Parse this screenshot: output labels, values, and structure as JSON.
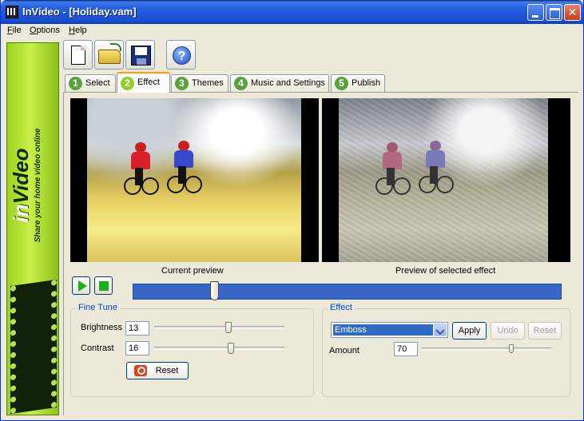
{
  "window": {
    "title": "InVideo - [Holiday.vam]"
  },
  "menu": [
    "File",
    "Options",
    "Help"
  ],
  "banner": {
    "logo_in": "in",
    "logo_video": "Video",
    "tagline": "Share your home video online"
  },
  "toolbar": {
    "buttons": [
      "new-icon",
      "open-folder-icon",
      "save-icon",
      "help-icon"
    ]
  },
  "tabs": [
    {
      "num": "1",
      "label": "Select"
    },
    {
      "num": "2",
      "label": "Effect"
    },
    {
      "num": "3",
      "label": "Themes"
    },
    {
      "num": "4",
      "label": "Music and Settings"
    },
    {
      "num": "5",
      "label": "Publish"
    }
  ],
  "active_tab": "Effect",
  "previews": {
    "current_caption": "Current preview",
    "effect_caption": "Preview of selected effect"
  },
  "playback": {
    "position_fraction": 0.19
  },
  "fine_tune": {
    "title": "Fine Tune",
    "brightness_label": "Brightness",
    "brightness_value": "13",
    "contrast_label": "Contrast",
    "contrast_value": "16",
    "reset_label": "Reset"
  },
  "effect": {
    "title": "Effect",
    "selected": "Emboss",
    "apply_label": "Apply",
    "undo_label": "Undo",
    "reset_label": "Reset",
    "amount_label": "Amount",
    "amount_value": "70"
  },
  "colors": {
    "accent": "#316ac5",
    "group_title": "#0046d5",
    "play_green": "#1ab01a"
  }
}
